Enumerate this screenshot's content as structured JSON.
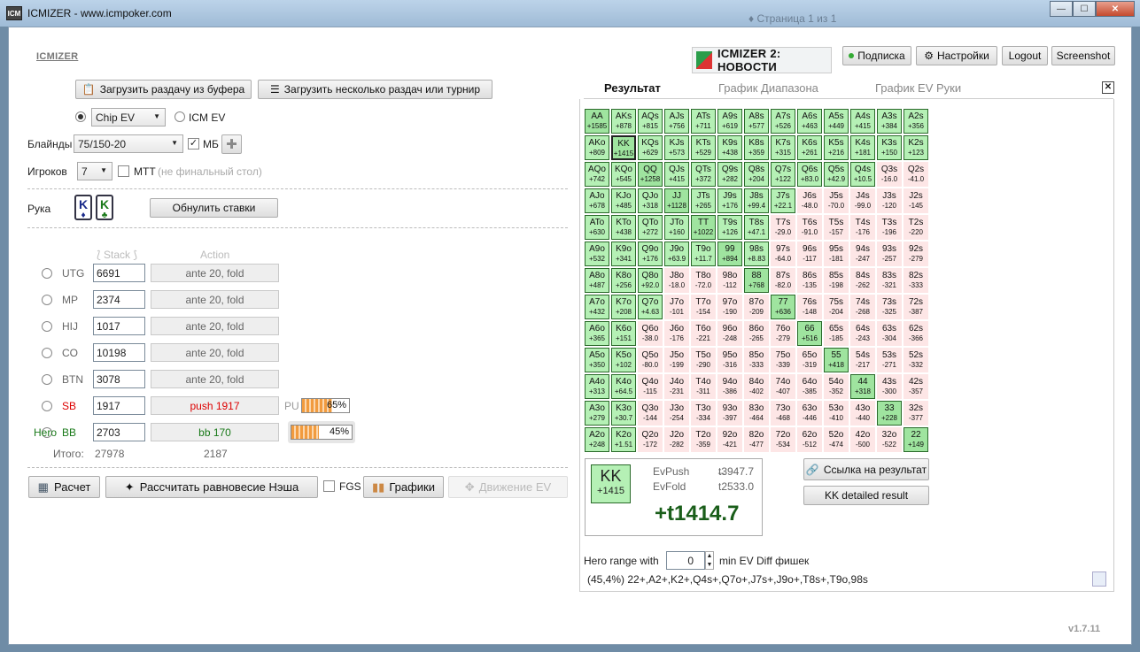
{
  "window": {
    "title": "ICMIZER - www.icmpoker.com",
    "icon": "ICM",
    "ghost": "♦ Страница 1 из 1",
    "btns": [
      "—",
      "☐",
      "✕"
    ]
  },
  "header": {
    "logo": "ICMIZER",
    "news": "ICMIZER 2: НОВОСТИ",
    "subscription": "Подписка",
    "settings": "Настройки",
    "logout": "Logout",
    "screenshot": "Screenshot"
  },
  "load": {
    "clipboard": "Загрузить раздачу из буфера",
    "multi": "Загрузить несколько раздач или турнир"
  },
  "mode": {
    "chip_ev": "Chip EV",
    "icm_ev": "ICM EV"
  },
  "blinds": {
    "label": "Блайнды",
    "value": "75/150-20",
    "mb": "МБ",
    "mb_check": "✓"
  },
  "players": {
    "label": "Игроков",
    "value": "7",
    "mtt": "МТТ",
    "mtt_note": "(не финальный стол)"
  },
  "hand": {
    "label": "Рука",
    "card1": "K",
    "card2": "K",
    "reset": "Обнулить ставки"
  },
  "table_head": {
    "stack": "Stack",
    "action": "Action"
  },
  "seats": [
    {
      "pos": "UTG",
      "stack": "6691",
      "action": "ante 20, fold",
      "color": "#666"
    },
    {
      "pos": "MP",
      "stack": "2374",
      "action": "ante 20, fold",
      "color": "#666"
    },
    {
      "pos": "HIJ",
      "stack": "1017",
      "action": "ante 20, fold",
      "color": "#666"
    },
    {
      "pos": "CO",
      "stack": "10198",
      "action": "ante 20, fold",
      "color": "#666"
    },
    {
      "pos": "BTN",
      "stack": "3078",
      "action": "ante 20, fold",
      "color": "#666"
    },
    {
      "pos": "SB",
      "stack": "1917",
      "action": "push 1917",
      "color": "#d00"
    },
    {
      "pos": "BB",
      "stack": "2703",
      "action": "bb 170",
      "color": "#1a7a1a",
      "hero": "Hero"
    }
  ],
  "sb_bar": {
    "prefix": "PU",
    "pct": "65%",
    "fill": 0.65
  },
  "bb_bar": {
    "pct": "45%",
    "fill": 0.45
  },
  "totals": {
    "label": "Итого:",
    "stack": "27978",
    "action": "2187"
  },
  "bottom": {
    "calc": "Расчет",
    "nash": "Рассчитать равновесие Нэша",
    "fgs": "FGS",
    "graphs": "Графики",
    "ev_move": "Движение EV"
  },
  "tabs": [
    "Результат",
    "График Диапазона",
    "График EV Руки"
  ],
  "grid": [
    [
      [
        "AA",
        "+1585",
        1
      ],
      [
        "AKs",
        "+878",
        1
      ],
      [
        "AQs",
        "+815",
        1
      ],
      [
        "AJs",
        "+756",
        1
      ],
      [
        "ATs",
        "+711",
        1
      ],
      [
        "A9s",
        "+619",
        1
      ],
      [
        "A8s",
        "+577",
        1
      ],
      [
        "A7s",
        "+526",
        1
      ],
      [
        "A6s",
        "+463",
        1
      ],
      [
        "A5s",
        "+449",
        1
      ],
      [
        "A4s",
        "+415",
        1
      ],
      [
        "A3s",
        "+384",
        1
      ],
      [
        "A2s",
        "+356",
        1
      ]
    ],
    [
      [
        "AKo",
        "+809",
        1
      ],
      [
        "KK",
        "+1415",
        1
      ],
      [
        "KQs",
        "+629",
        1
      ],
      [
        "KJs",
        "+573",
        1
      ],
      [
        "KTs",
        "+529",
        1
      ],
      [
        "K9s",
        "+438",
        1
      ],
      [
        "K8s",
        "+359",
        1
      ],
      [
        "K7s",
        "+315",
        1
      ],
      [
        "K6s",
        "+261",
        1
      ],
      [
        "K5s",
        "+216",
        1
      ],
      [
        "K4s",
        "+181",
        1
      ],
      [
        "K3s",
        "+150",
        1
      ],
      [
        "K2s",
        "+123",
        1
      ]
    ],
    [
      [
        "AQo",
        "+742",
        1
      ],
      [
        "KQo",
        "+545",
        1
      ],
      [
        "QQ",
        "+1258",
        1
      ],
      [
        "QJs",
        "+415",
        1
      ],
      [
        "QTs",
        "+372",
        1
      ],
      [
        "Q9s",
        "+282",
        1
      ],
      [
        "Q8s",
        "+204",
        1
      ],
      [
        "Q7s",
        "+122",
        1
      ],
      [
        "Q6s",
        "+83.0",
        1
      ],
      [
        "Q5s",
        "+42.9",
        1
      ],
      [
        "Q4s",
        "+10.5",
        1
      ],
      [
        "Q3s",
        "-16.0",
        0
      ],
      [
        "Q2s",
        "-41.0",
        0
      ]
    ],
    [
      [
        "AJo",
        "+678",
        1
      ],
      [
        "KJo",
        "+485",
        1
      ],
      [
        "QJo",
        "+318",
        1
      ],
      [
        "JJ",
        "+1128",
        1
      ],
      [
        "JTs",
        "+265",
        1
      ],
      [
        "J9s",
        "+176",
        1
      ],
      [
        "J8s",
        "+99.4",
        1
      ],
      [
        "J7s",
        "+22.1",
        1
      ],
      [
        "J6s",
        "-48.0",
        0
      ],
      [
        "J5s",
        "-70.0",
        0
      ],
      [
        "J4s",
        "-99.0",
        0
      ],
      [
        "J3s",
        "-120",
        0
      ],
      [
        "J2s",
        "-145",
        0
      ]
    ],
    [
      [
        "ATo",
        "+630",
        1
      ],
      [
        "KTo",
        "+438",
        1
      ],
      [
        "QTo",
        "+272",
        1
      ],
      [
        "JTo",
        "+160",
        1
      ],
      [
        "TT",
        "+1022",
        1
      ],
      [
        "T9s",
        "+126",
        1
      ],
      [
        "T8s",
        "+47.1",
        1
      ],
      [
        "T7s",
        "-29.0",
        0
      ],
      [
        "T6s",
        "-91.0",
        0
      ],
      [
        "T5s",
        "-157",
        0
      ],
      [
        "T4s",
        "-176",
        0
      ],
      [
        "T3s",
        "-196",
        0
      ],
      [
        "T2s",
        "-220",
        0
      ]
    ],
    [
      [
        "A9o",
        "+532",
        1
      ],
      [
        "K9o",
        "+341",
        1
      ],
      [
        "Q9o",
        "+176",
        1
      ],
      [
        "J9o",
        "+63.9",
        1
      ],
      [
        "T9o",
        "+11.7",
        1
      ],
      [
        "99",
        "+894",
        1
      ],
      [
        "98s",
        "+8.83",
        1
      ],
      [
        "97s",
        "-64.0",
        0
      ],
      [
        "96s",
        "-117",
        0
      ],
      [
        "95s",
        "-181",
        0
      ],
      [
        "94s",
        "-247",
        0
      ],
      [
        "93s",
        "-257",
        0
      ],
      [
        "92s",
        "-279",
        0
      ]
    ],
    [
      [
        "A8o",
        "+487",
        1
      ],
      [
        "K8o",
        "+256",
        1
      ],
      [
        "Q8o",
        "+92.0",
        1
      ],
      [
        "J8o",
        "-18.0",
        0
      ],
      [
        "T8o",
        "-72.0",
        0
      ],
      [
        "98o",
        "-112",
        0
      ],
      [
        "88",
        "+768",
        1
      ],
      [
        "87s",
        "-82.0",
        0
      ],
      [
        "86s",
        "-135",
        0
      ],
      [
        "85s",
        "-198",
        0
      ],
      [
        "84s",
        "-262",
        0
      ],
      [
        "83s",
        "-321",
        0
      ],
      [
        "82s",
        "-333",
        0
      ]
    ],
    [
      [
        "A7o",
        "+432",
        1
      ],
      [
        "K7o",
        "+208",
        1
      ],
      [
        "Q7o",
        "+4.63",
        1
      ],
      [
        "J7o",
        "-101",
        0
      ],
      [
        "T7o",
        "-154",
        0
      ],
      [
        "97o",
        "-190",
        0
      ],
      [
        "87o",
        "-209",
        0
      ],
      [
        "77",
        "+636",
        1
      ],
      [
        "76s",
        "-148",
        0
      ],
      [
        "75s",
        "-204",
        0
      ],
      [
        "74s",
        "-268",
        0
      ],
      [
        "73s",
        "-325",
        0
      ],
      [
        "72s",
        "-387",
        0
      ]
    ],
    [
      [
        "A6o",
        "+365",
        1
      ],
      [
        "K6o",
        "+151",
        1
      ],
      [
        "Q6o",
        "-38.0",
        0
      ],
      [
        "J6o",
        "-176",
        0
      ],
      [
        "T6o",
        "-221",
        0
      ],
      [
        "96o",
        "-248",
        0
      ],
      [
        "86o",
        "-265",
        0
      ],
      [
        "76o",
        "-279",
        0
      ],
      [
        "66",
        "+516",
        1
      ],
      [
        "65s",
        "-185",
        0
      ],
      [
        "64s",
        "-243",
        0
      ],
      [
        "63s",
        "-304",
        0
      ],
      [
        "62s",
        "-366",
        0
      ]
    ],
    [
      [
        "A5o",
        "+350",
        1
      ],
      [
        "K5o",
        "+102",
        1
      ],
      [
        "Q5o",
        "-80.0",
        0
      ],
      [
        "J5o",
        "-199",
        0
      ],
      [
        "T5o",
        "-290",
        0
      ],
      [
        "95o",
        "-316",
        0
      ],
      [
        "85o",
        "-333",
        0
      ],
      [
        "75o",
        "-339",
        0
      ],
      [
        "65o",
        "-319",
        0
      ],
      [
        "55",
        "+418",
        1
      ],
      [
        "54s",
        "-217",
        0
      ],
      [
        "53s",
        "-271",
        0
      ],
      [
        "52s",
        "-332",
        0
      ]
    ],
    [
      [
        "A4o",
        "+313",
        1
      ],
      [
        "K4o",
        "+64.5",
        1
      ],
      [
        "Q4o",
        "-115",
        0
      ],
      [
        "J4o",
        "-231",
        0
      ],
      [
        "T4o",
        "-311",
        0
      ],
      [
        "94o",
        "-386",
        0
      ],
      [
        "84o",
        "-402",
        0
      ],
      [
        "74o",
        "-407",
        0
      ],
      [
        "64o",
        "-385",
        0
      ],
      [
        "54o",
        "-352",
        0
      ],
      [
        "44",
        "+318",
        1
      ],
      [
        "43s",
        "-300",
        0
      ],
      [
        "42s",
        "-357",
        0
      ]
    ],
    [
      [
        "A3o",
        "+279",
        1
      ],
      [
        "K3o",
        "+30.7",
        1
      ],
      [
        "Q3o",
        "-144",
        0
      ],
      [
        "J3o",
        "-254",
        0
      ],
      [
        "T3o",
        "-334",
        0
      ],
      [
        "93o",
        "-397",
        0
      ],
      [
        "83o",
        "-464",
        0
      ],
      [
        "73o",
        "-468",
        0
      ],
      [
        "63o",
        "-446",
        0
      ],
      [
        "53o",
        "-410",
        0
      ],
      [
        "43o",
        "-440",
        0
      ],
      [
        "33",
        "+228",
        1
      ],
      [
        "32s",
        "-377",
        0
      ]
    ],
    [
      [
        "A2o",
        "+248",
        1
      ],
      [
        "K2o",
        "+1.51",
        1
      ],
      [
        "Q2o",
        "-172",
        0
      ],
      [
        "J2o",
        "-282",
        0
      ],
      [
        "T2o",
        "-359",
        0
      ],
      [
        "92o",
        "-421",
        0
      ],
      [
        "82o",
        "-477",
        0
      ],
      [
        "72o",
        "-534",
        0
      ],
      [
        "62o",
        "-512",
        0
      ],
      [
        "52o",
        "-474",
        0
      ],
      [
        "42o",
        "-500",
        0
      ],
      [
        "32o",
        "-522",
        0
      ],
      [
        "22",
        "+149",
        1
      ]
    ]
  ],
  "result": {
    "hand": "KK",
    "ev": "+1415",
    "evpush_label": "EvPush",
    "evpush": "t3947.7",
    "evfold_label": "EvFold",
    "evfold": "t2533.0",
    "dash": "_",
    "diff": "+t1414.7"
  },
  "links": {
    "link": "Ссылка на результат",
    "detailed": "KK detailed result"
  },
  "hero_range": {
    "label": "Hero range with",
    "value": "0",
    "suffix": "min EV Diff фишек",
    "range": "(45,4%) 22+,A2+,K2+,Q4s+,Q7o+,J7s+,J9o+,T8s+,T9o,98s"
  },
  "version": "v1.7.11",
  "colors": {
    "in_range": "#b5f0b5",
    "out_range": "#fde6e6",
    "accent": "#1a5e1a"
  }
}
